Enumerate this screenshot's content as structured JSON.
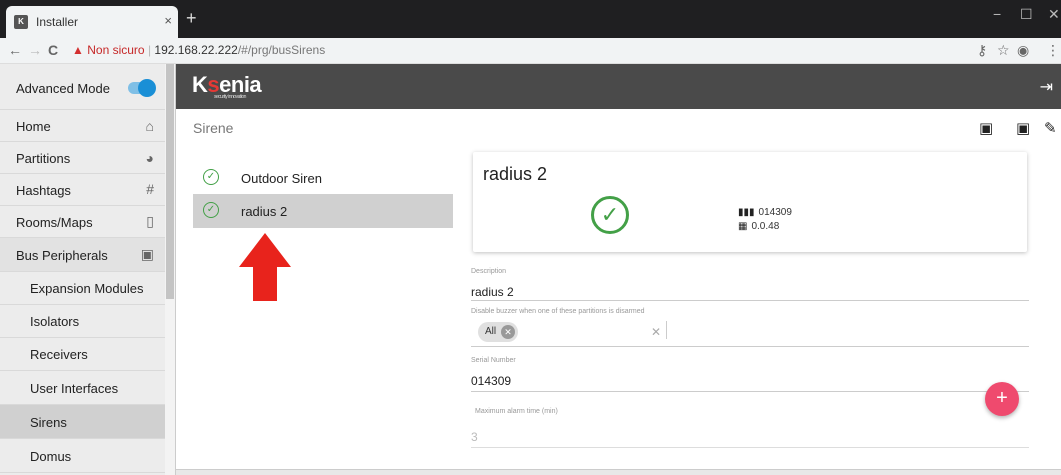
{
  "browser": {
    "tab_title": "Installer",
    "tab_favicon": "ksenia-favicon",
    "tab_close": "×",
    "new_tab": "+",
    "window_controls": {
      "minimize": "−",
      "maximize": "☐",
      "close": "✕"
    },
    "nav": {
      "back": "←",
      "forward": "→",
      "reload": "C"
    },
    "security_warning": "▲",
    "security_label": "Non sicuro",
    "url_host": "192.168.22.222",
    "url_path": "/#/prg/busSirens",
    "toolbar_icons": [
      "key-icon",
      "star-icon",
      "account-icon",
      "menu-icon"
    ]
  },
  "sidebar": {
    "advanced_mode_label": "Advanced Mode",
    "advanced_mode_on": true,
    "items": [
      {
        "label": "Home",
        "icon": "home-icon",
        "glyph": "🏠"
      },
      {
        "label": "Partitions",
        "icon": "pie-chart-icon",
        "glyph": "◕"
      },
      {
        "label": "Hashtags",
        "icon": "hashtag-icon",
        "glyph": "#"
      },
      {
        "label": "Rooms/Maps",
        "icon": "door-icon",
        "glyph": "▯"
      },
      {
        "label": "Bus Peripherals",
        "icon": "device-icon",
        "glyph": "▣"
      }
    ],
    "sub_items": [
      {
        "label": "Expansion Modules"
      },
      {
        "label": "Isolators"
      },
      {
        "label": "Receivers"
      },
      {
        "label": "User Interfaces"
      },
      {
        "label": "Sirens",
        "selected": true
      },
      {
        "label": "Domus"
      }
    ]
  },
  "header": {
    "logo_prefix": "K",
    "logo_s": "s",
    "logo_rest": "enia",
    "logo_sub": "security innovation",
    "logout_icon": "⇥"
  },
  "page": {
    "title": "Sirene",
    "toolbar_icons": [
      "archive-icon",
      "archive-icon",
      "edit-icon"
    ]
  },
  "sirens": [
    {
      "label": "Outdoor Siren",
      "selected": false
    },
    {
      "label": "radius 2",
      "selected": true
    }
  ],
  "detail": {
    "title": "radius 2",
    "status_icon": "check-circle-icon",
    "serial_label": "014309",
    "firmware_label": "0.0.48"
  },
  "form": {
    "description_label": "Description",
    "description_value": "radius 2",
    "buzzer_label": "Disable buzzer when one of these partitions is disarmed",
    "buzzer_chip": "All",
    "serial_label": "Serial Number",
    "serial_value": "014309",
    "alarm_time_label": "Maximum alarm time (min)",
    "alarm_time_value": "3"
  },
  "colors": {
    "accent_blue": "#1a8fd6",
    "check_green": "#43a047",
    "fab_pink": "#ef4a6e",
    "arrow_red": "#e8231c",
    "header_gray": "#4a4a4a"
  }
}
